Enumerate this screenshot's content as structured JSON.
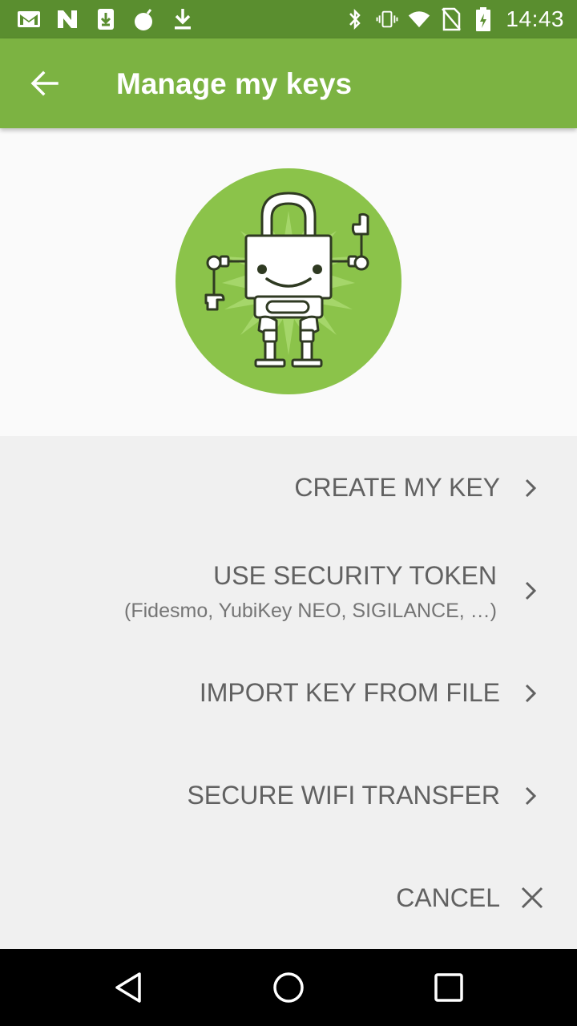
{
  "status_bar": {
    "left_icons": [
      "gmail-icon",
      "n-app-icon",
      "download-box-icon",
      "bomb-icon",
      "download-icon"
    ],
    "right_icons": [
      "bluetooth-icon",
      "vibrate-icon",
      "wifi-icon",
      "no-sim-icon",
      "battery-charging-icon"
    ],
    "time": "14:43"
  },
  "app_bar": {
    "title": "Manage my keys",
    "back_icon": "arrow-left-icon"
  },
  "hero": {
    "illustration": "robot-padlock-illustration",
    "colors": {
      "circle": "#8bc34a",
      "burst": "#a5d66a"
    }
  },
  "menu": {
    "create_key": "CREATE MY KEY",
    "security_token": "USE SECURITY TOKEN",
    "security_token_sub": "(Fidesmo, YubiKey NEO, SIGILANCE, …)",
    "import_file": "IMPORT KEY FROM FILE",
    "wifi_transfer": "SECURE WIFI TRANSFER",
    "cancel": "CANCEL"
  },
  "nav_bar": {
    "icons": [
      "back-triangle-icon",
      "home-circle-icon",
      "recents-square-icon"
    ]
  },
  "colors": {
    "status_bar": "#5a8e2f",
    "app_bar": "#7cb342",
    "menu_text": "#616161"
  }
}
